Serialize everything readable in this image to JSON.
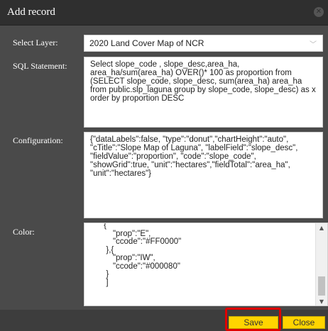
{
  "dialog": {
    "title": "Add record",
    "close_icon": "close-icon"
  },
  "labels": {
    "select_layer": "Select Layer:",
    "sql_statement": "SQL Statement:",
    "configuration": "Configuration:",
    "color": "Color:"
  },
  "select_layer": {
    "value": "2020 Land Cover Map of NCR",
    "chevron_icon": "chevron-down-icon"
  },
  "sql_statement": {
    "value": "Select slope_code , slope_desc,area_ha, area_ha/sum(area_ha) OVER()* 100 as proportion from (SELECT slope_code, slope_desc, sum(area_ha) area_ha from public.slp_laguna group by slope_code, slope_desc) as x order by proportion DESC"
  },
  "configuration": {
    "value": "{\"dataLabels\":false, \"type\":\"donut\",\"chartHeight\":\"auto\", \"cTitle\":\"Slope Map of Laguna\", \"labelField\":\"slope_desc\", \"fieldValue\":\"proportion\", \"code\":\"slope_code\", \"showGrid\":true, \"unit\":\"hectares\",\"fieldTotal\":\"area_ha\", \"unit\":\"hectares\"}"
  },
  "color": {
    "value": "      {\n          \"prop\":\"E\",\n          \"ccode\":\"#FF0000\"\n       },{\n          \"prop\":\"IW\",\n          \"ccode\":\"#000080\"\n       }\n       ]"
  },
  "buttons": {
    "save": "Save",
    "close": "Close"
  },
  "colors": {
    "button_accent": "#ffd400",
    "highlight": "#e00000"
  }
}
